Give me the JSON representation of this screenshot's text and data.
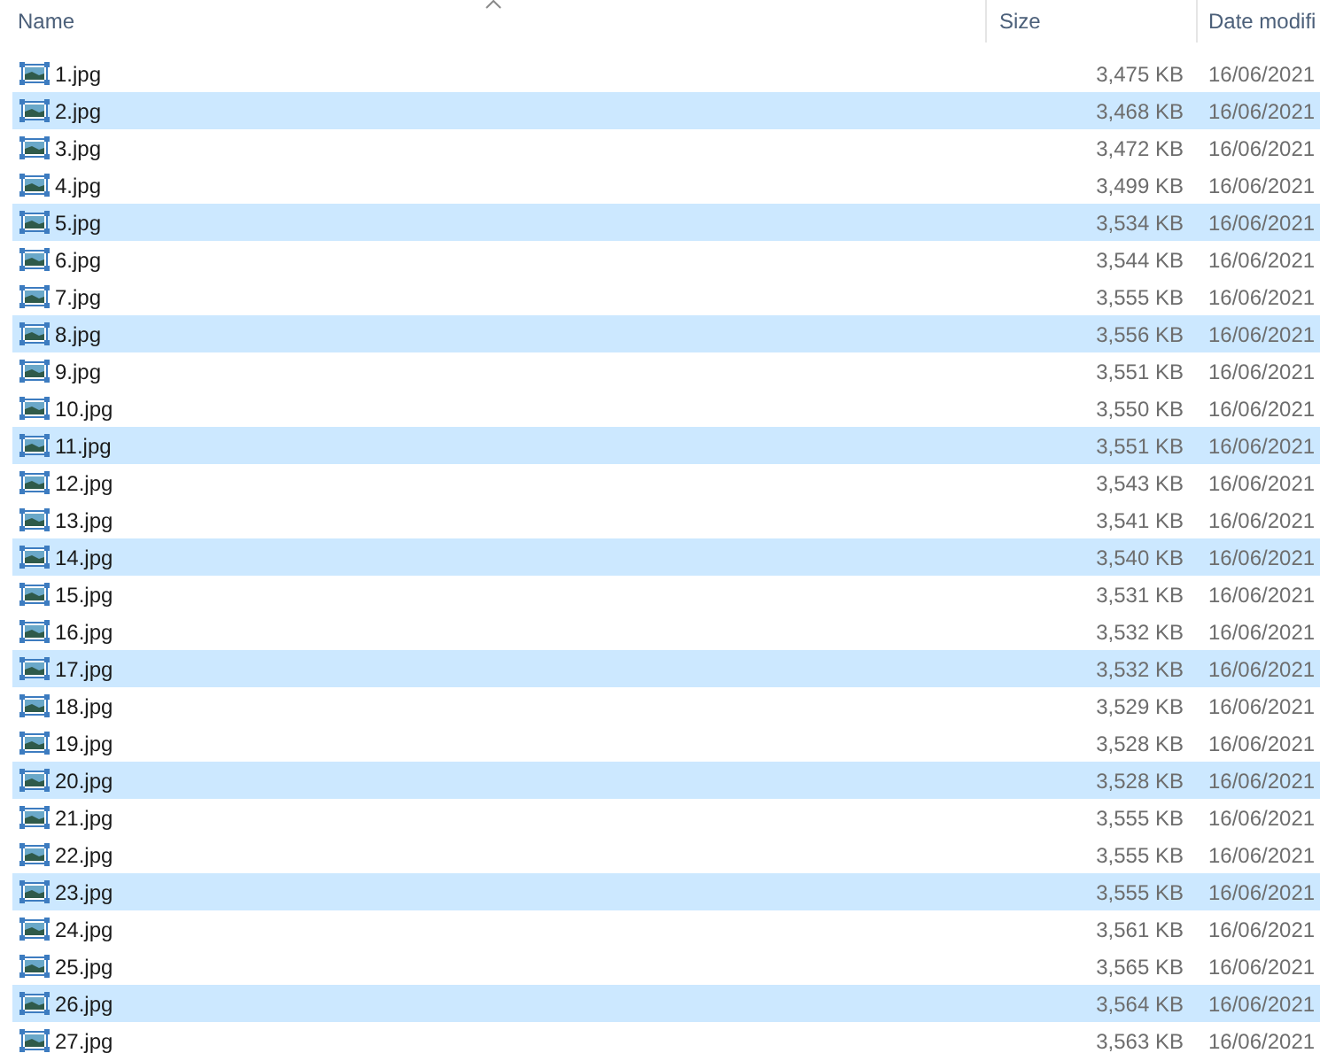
{
  "table": {
    "columns": [
      {
        "label": "Name",
        "sorted": true
      },
      {
        "label": "Size",
        "sorted": false
      },
      {
        "label": "Date modifi",
        "sorted": false
      }
    ],
    "rows": [
      {
        "name": "1.jpg",
        "size": "3,475 KB",
        "date": "16/06/2021",
        "selected": false
      },
      {
        "name": "2.jpg",
        "size": "3,468 KB",
        "date": "16/06/2021",
        "selected": true
      },
      {
        "name": "3.jpg",
        "size": "3,472 KB",
        "date": "16/06/2021",
        "selected": false
      },
      {
        "name": "4.jpg",
        "size": "3,499 KB",
        "date": "16/06/2021",
        "selected": false
      },
      {
        "name": "5.jpg",
        "size": "3,534 KB",
        "date": "16/06/2021",
        "selected": true
      },
      {
        "name": "6.jpg",
        "size": "3,544 KB",
        "date": "16/06/2021",
        "selected": false
      },
      {
        "name": "7.jpg",
        "size": "3,555 KB",
        "date": "16/06/2021",
        "selected": false
      },
      {
        "name": "8.jpg",
        "size": "3,556 KB",
        "date": "16/06/2021",
        "selected": true
      },
      {
        "name": "9.jpg",
        "size": "3,551 KB",
        "date": "16/06/2021",
        "selected": false
      },
      {
        "name": "10.jpg",
        "size": "3,550 KB",
        "date": "16/06/2021",
        "selected": false
      },
      {
        "name": "11.jpg",
        "size": "3,551 KB",
        "date": "16/06/2021",
        "selected": true
      },
      {
        "name": "12.jpg",
        "size": "3,543 KB",
        "date": "16/06/2021",
        "selected": false
      },
      {
        "name": "13.jpg",
        "size": "3,541 KB",
        "date": "16/06/2021",
        "selected": false
      },
      {
        "name": "14.jpg",
        "size": "3,540 KB",
        "date": "16/06/2021",
        "selected": true
      },
      {
        "name": "15.jpg",
        "size": "3,531 KB",
        "date": "16/06/2021",
        "selected": false
      },
      {
        "name": "16.jpg",
        "size": "3,532 KB",
        "date": "16/06/2021",
        "selected": false
      },
      {
        "name": "17.jpg",
        "size": "3,532 KB",
        "date": "16/06/2021",
        "selected": true
      },
      {
        "name": "18.jpg",
        "size": "3,529 KB",
        "date": "16/06/2021",
        "selected": false
      },
      {
        "name": "19.jpg",
        "size": "3,528 KB",
        "date": "16/06/2021",
        "selected": false
      },
      {
        "name": "20.jpg",
        "size": "3,528 KB",
        "date": "16/06/2021",
        "selected": true
      },
      {
        "name": "21.jpg",
        "size": "3,555 KB",
        "date": "16/06/2021",
        "selected": false
      },
      {
        "name": "22.jpg",
        "size": "3,555 KB",
        "date": "16/06/2021",
        "selected": false
      },
      {
        "name": "23.jpg",
        "size": "3,555 KB",
        "date": "16/06/2021",
        "selected": true
      },
      {
        "name": "24.jpg",
        "size": "3,561 KB",
        "date": "16/06/2021",
        "selected": false
      },
      {
        "name": "25.jpg",
        "size": "3,565 KB",
        "date": "16/06/2021",
        "selected": false
      },
      {
        "name": "26.jpg",
        "size": "3,564 KB",
        "date": "16/06/2021",
        "selected": true
      },
      {
        "name": "27.jpg",
        "size": "3,563 KB",
        "date": "16/06/2021",
        "selected": false
      }
    ]
  }
}
